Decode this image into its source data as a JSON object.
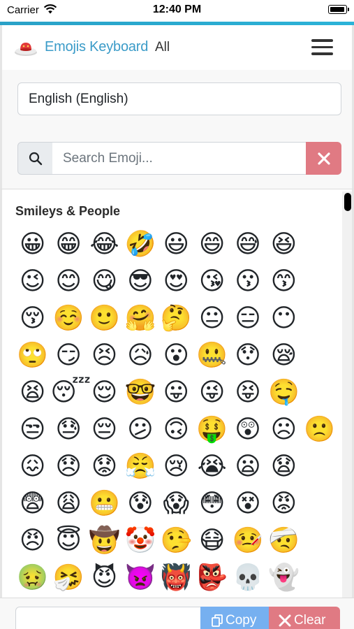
{
  "status_bar": {
    "carrier": "Carrier",
    "time": "12:40 PM"
  },
  "header": {
    "brand": "Emojis Keyboard",
    "filter": "All"
  },
  "language": {
    "selected": "English (English)"
  },
  "search": {
    "placeholder": "Search Emoji...",
    "value": ""
  },
  "category": {
    "title": "Smileys & People"
  },
  "emoji_rows": [
    [
      "😀",
      "😁",
      "😂",
      "🤣",
      "😃",
      "😄",
      "😅",
      "😆"
    ],
    [
      "😉",
      "😊",
      "😋",
      "😎",
      "😍",
      "😘",
      "😗",
      "😙"
    ],
    [
      "😚",
      "☺️",
      "🙂",
      "🤗",
      "🤔",
      "😐",
      "😑",
      "😶"
    ],
    [
      "🙄",
      "😏",
      "😣",
      "😥",
      "😮",
      "🤐",
      "😯",
      "😪"
    ],
    [
      "😫",
      "😴",
      "😌",
      "🤓",
      "😛",
      "😜",
      "😝",
      "🤤"
    ],
    [
      "😒",
      "😓",
      "😔",
      "😕",
      "🙃",
      "🤑",
      "😲",
      "☹",
      "🙁"
    ],
    [
      "😖",
      "😞",
      "😟",
      "😤",
      "😢",
      "😭",
      "😦",
      "😧"
    ],
    [
      "😨",
      "😩",
      "😬",
      "😰",
      "😱",
      "😳",
      "😵",
      "😡"
    ],
    [
      "😠",
      "😇",
      "🤠",
      "🤡",
      "🤥",
      "😷",
      "🤒",
      "🤕"
    ],
    [
      "🤢",
      "🤧",
      "😈",
      "👿",
      "👹",
      "👺",
      "💀",
      "👻"
    ]
  ],
  "actions": {
    "copy_label": "Copy",
    "clear_label": "Clear"
  },
  "colors": {
    "accent": "#2aa1c7",
    "brand": "#3a9bc8",
    "danger": "#e07a83",
    "primary": "#76b0f0"
  }
}
